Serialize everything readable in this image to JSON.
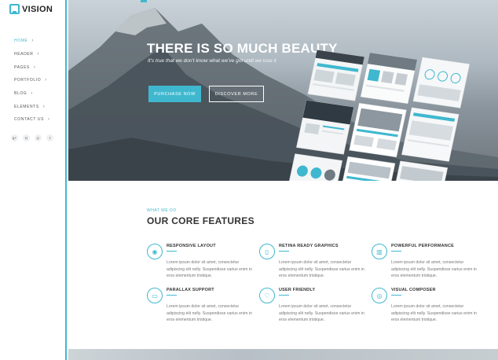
{
  "logo": {
    "text": "VISION"
  },
  "nav": [
    {
      "label": "HOME",
      "active": true
    },
    {
      "label": "HEADER"
    },
    {
      "label": "PAGES"
    },
    {
      "label": "PORTFOLIO"
    },
    {
      "label": "BLOG"
    },
    {
      "label": "ELEMENTS"
    },
    {
      "label": "CONTACT US"
    }
  ],
  "socials": [
    "google-plus-icon",
    "instagram-icon",
    "pinterest-icon",
    "twitter-icon"
  ],
  "hero": {
    "title": "THERE IS SO MUCH BEAUTY",
    "subtitle": "It's true that we don't know what we've got until we lose it",
    "purchase_label": "PURCHASE NOW",
    "discover_label": "DISCOVER MORE"
  },
  "features": {
    "eyebrow": "WHAT WE DO",
    "title": "OUR CORE FEATURES",
    "items": [
      {
        "name": "RESPONSIVE LAYOUT",
        "icon": "camera-icon",
        "text": "Lorem ipsum dolor sit amet, consectetur adipiscing elit nelly. Suspendisse varius enim in eros elementum tristique."
      },
      {
        "name": "RETINA READY GRAPHICS",
        "icon": "mobile-icon",
        "text": "Lorem ipsum dolor sit amet, consectetur adipiscing elit nelly. Suspendisse varius enim in eros elementum tristique."
      },
      {
        "name": "POWERFUL PERFORMANCE",
        "icon": "chart-icon",
        "text": "Lorem ipsum dolor sit amet, consectetur adipiscing elit nelly. Suspendisse varius enim in eros elementum tristique."
      },
      {
        "name": "PARALLAX SUPPORT",
        "icon": "monitor-icon",
        "text": "Lorem ipsum dolor sit amet, consectetur adipiscing elit nelly. Suspendisse varius enim in eros elementum tristique."
      },
      {
        "name": "USER FRIENDLY",
        "icon": "heart-icon",
        "text": "Lorem ipsum dolor sit amet, consectetur adipiscing elit nelly. Suspendisse varius enim in eros elementum tristique."
      },
      {
        "name": "VISUAL COMPOSER",
        "icon": "circle-icon",
        "text": "Lorem ipsum dolor sit amet, consectetur adipiscing elit nelly. Suspendisse varius enim in eros elementum tristique."
      }
    ]
  },
  "colors": {
    "accent": "#3fb8cf",
    "text": "#333333",
    "muted": "#777777"
  }
}
